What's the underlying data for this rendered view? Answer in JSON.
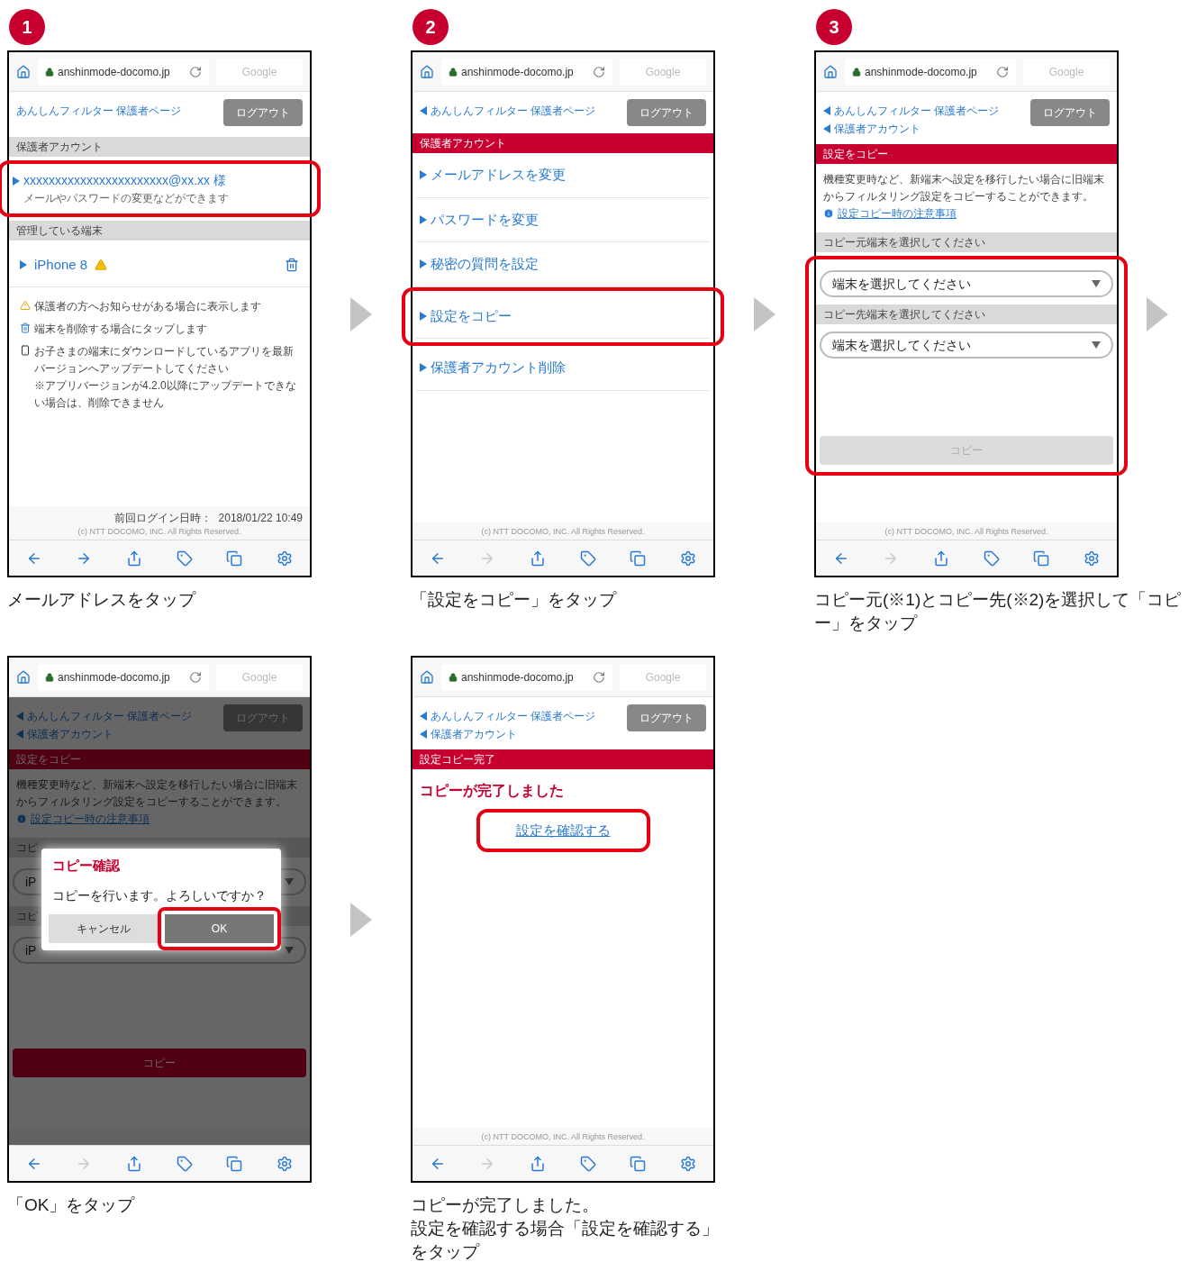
{
  "steps": [
    {
      "number": "1",
      "arrow_after": true,
      "screen": {
        "url": "anshinmode-docomo.jp",
        "search_placeholder": "Google",
        "forward_enabled": true,
        "breadcrumbs": [
          {
            "text": "あんしんフィルター 保護者ページ",
            "back": false
          }
        ],
        "logout": "ログアウト",
        "blocks": [
          {
            "kind": "gray_heading",
            "text": "保護者アカウント"
          },
          {
            "kind": "highlight",
            "compact": false,
            "children": [
              {
                "kind": "account_item",
                "text": "xxxxxxxxxxxxxxxxxxxxxxx@xx.xx 様",
                "subtext": "メールやパスワードの変更などができます"
              }
            ]
          },
          {
            "kind": "gray_heading",
            "text": "管理している端末"
          },
          {
            "kind": "device_item",
            "text": "iPhone 8",
            "warning": true
          },
          {
            "kind": "notes",
            "items": [
              {
                "kind": "warning",
                "text": "保護者の方へお知らせがある場合に表示します"
              },
              {
                "kind": "trash",
                "text": "端末を削除する場合にタップします"
              },
              {
                "kind": "phone",
                "text": "お子さまの端末にダウンロードしているアプリを最新バージョンへアップデートしてください\n※アプリバージョンが4.2.0以降にアップデートできない場合は、削除できません"
              }
            ]
          }
        ],
        "footer": {
          "login_label": "前回ログイン日時：",
          "login_time": "2018/01/22 10:49",
          "copyright": "(c) NTT DOCOMO, INC. All Rights Reserved."
        }
      },
      "caption": [
        "メールアドレスをタップ"
      ]
    },
    {
      "number": "2",
      "arrow_after": true,
      "screen": {
        "url": "anshinmode-docomo.jp",
        "search_placeholder": "Google",
        "forward_enabled": false,
        "breadcrumbs": [
          {
            "text": "あんしんフィルター 保護者ページ",
            "back": true
          }
        ],
        "logout": "ログアウト",
        "blocks": [
          {
            "kind": "red_heading",
            "text": "保護者アカウント"
          },
          {
            "kind": "menu_item",
            "text": "メールアドレスを変更"
          },
          {
            "kind": "menu_item",
            "text": "パスワードを変更"
          },
          {
            "kind": "menu_item",
            "text": "秘密の質問を設定"
          },
          {
            "kind": "highlight",
            "compact": false,
            "children": [
              {
                "kind": "menu_item",
                "text": "設定をコピー"
              }
            ]
          },
          {
            "kind": "menu_item",
            "text": "保護者アカウント削除"
          }
        ],
        "footer": {
          "copyright": "(c) NTT DOCOMO, INC. All Rights Reserved."
        }
      },
      "caption": [
        "「設定をコピー」をタップ"
      ]
    },
    {
      "number": "3",
      "arrow_after": true,
      "screen": {
        "url": "anshinmode-docomo.jp",
        "search_placeholder": "Google",
        "forward_enabled": false,
        "breadcrumbs": [
          {
            "text": "あんしんフィルター 保護者ページ",
            "back": true
          },
          {
            "text": "保護者アカウント",
            "back": true
          }
        ],
        "logout": "ログアウト",
        "blocks": [
          {
            "kind": "red_heading",
            "text": "設定をコピー"
          },
          {
            "kind": "description",
            "text": "機種変更時など、新端末へ設定を移行したい場合に旧端末からフィルタリング設定をコピーすることができます。"
          },
          {
            "kind": "link",
            "text": "設定コピー時の注意事項"
          },
          {
            "kind": "gray_heading",
            "text": "コピー元端末を選択してください"
          },
          {
            "kind": "highlight",
            "compact": false,
            "children": [
              {
                "kind": "select",
                "text": "端末を選択してください"
              },
              {
                "kind": "gray_heading",
                "text": "コピー先端末を選択してください"
              },
              {
                "kind": "select",
                "text": "端末を選択してください"
              },
              {
                "kind": "button",
                "text": "コピー",
                "disabled": true
              }
            ]
          }
        ],
        "footer": {
          "copyright": "(c) NTT DOCOMO, INC. All Rights Reserved."
        }
      },
      "caption": [
        "コピー元(※1)とコピー先(※2)を選択して「コピー」をタップ"
      ]
    },
    {
      "arrow_after": true,
      "screen": {
        "url": "anshinmode-docomo.jp",
        "search_placeholder": "Google",
        "forward_enabled": false,
        "dimmed": true,
        "breadcrumbs": [
          {
            "text": "あんしんフィルター 保護者ページ",
            "back": true
          },
          {
            "text": "保護者アカウント",
            "back": true
          }
        ],
        "logout": "ログアウト",
        "blocks": [
          {
            "kind": "red_heading",
            "text": "設定をコピー"
          },
          {
            "kind": "description",
            "text": "機種変更時など、新端末へ設定を移行したい場合に旧端末からフィルタリング設定をコピーすることができます。"
          },
          {
            "kind": "link",
            "text": "設定コピー時の注意事項"
          },
          {
            "kind": "gray_heading",
            "text": "コピ"
          },
          {
            "kind": "select",
            "text": "iP"
          },
          {
            "kind": "gray_heading",
            "text": "コピ"
          },
          {
            "kind": "select",
            "text": "iP"
          },
          {
            "kind": "button",
            "text": "コピー",
            "disabled": false
          }
        ],
        "dialog": {
          "title": "コピー確認",
          "message": "コピーを行います。よろしいですか？",
          "buttons": [
            {
              "label": "キャンセル",
              "kind": "secondary",
              "highlighted": false
            },
            {
              "label": "OK",
              "kind": "primary",
              "highlighted": true
            }
          ]
        }
      },
      "caption": [
        "「OK」をタップ"
      ]
    },
    {
      "screen": {
        "url": "anshinmode-docomo.jp",
        "search_placeholder": "Google",
        "forward_enabled": false,
        "breadcrumbs": [
          {
            "text": "あんしんフィルター 保護者ページ",
            "back": true
          },
          {
            "text": "保護者アカウント",
            "back": true
          }
        ],
        "logout": "ログアウト",
        "blocks": [
          {
            "kind": "red_heading",
            "text": "設定コピー完了"
          },
          {
            "kind": "message",
            "text": "コピーが完了しました"
          },
          {
            "kind": "highlight",
            "compact": true,
            "children": [
              {
                "kind": "center_link",
                "text": "設定を確認する"
              }
            ]
          }
        ],
        "footer": {
          "copyright": "(c) NTT DOCOMO, INC. All Rights Reserved."
        }
      },
      "caption": [
        "コピーが完了しました。",
        "設定を確認する場合「設定を確認する」をタップ"
      ]
    }
  ]
}
